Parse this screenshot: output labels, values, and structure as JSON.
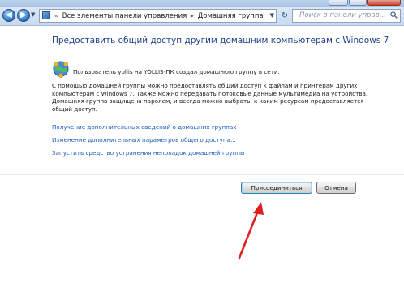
{
  "window": {
    "close_icon": "close-icon"
  },
  "navigation": {
    "back_icon": "back-arrow-icon",
    "forward_icon": "forward-arrow-icon",
    "address_icon": "control-panel-icon",
    "address_separator_glyph": "«",
    "breadcrumb": [
      "Все элементы панели управления",
      "Домашняя группа"
    ],
    "crumb_separator_glyph": "▸",
    "refresh_glyph": "↻",
    "search_placeholder": "Поиск в панели управ..."
  },
  "homegroup": {
    "heading": "Предоставить общий доступ другим домашним компьютерам с Windows 7",
    "icon": "homegroup-icon",
    "notice": "Пользователь yollis на YOLLIS-ПК создал домашнюю группу в сети.",
    "description_lines": [
      "С помощью домашней группы можно предоставлять общий доступ к файлам и принтерам других",
      "компьютерам с Windows 7. Также можно передавать потоковые данные мультимедиа на устройства.",
      "Домашняя группа защищена паролем, и всегда можно выбрать, к каким ресурсам предоставляется",
      "общий доступ."
    ],
    "links": [
      "Получение дополнительных сведений о домашних группах",
      "Изменение дополнительных параметров общего доступа...",
      "Запустить средство устранения неполадок домашней группы"
    ],
    "buttons": {
      "join": "Присоединиться",
      "cancel": "Отмена"
    }
  },
  "annotation": {
    "arrow_color": "#e02020"
  }
}
